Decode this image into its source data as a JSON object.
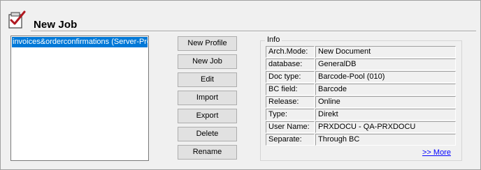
{
  "header": {
    "title": "New Job",
    "icon": "clipboard-check-icon"
  },
  "profile_list": {
    "items": [
      {
        "label": "invoices&orderconfirmations (Server-Profil",
        "selected": true
      }
    ]
  },
  "buttons": {
    "new_profile": "New Profile",
    "new_job": "New Job",
    "edit": "Edit",
    "import": "Import",
    "export": "Export",
    "delete": "Delete",
    "rename": "Rename"
  },
  "info": {
    "group_label": "Info",
    "rows": [
      {
        "key": "Arch.Mode:",
        "value": "New Document"
      },
      {
        "key": "database:",
        "value": "GeneralDB"
      },
      {
        "key": "Doc type:",
        "value": "Barcode-Pool (010)"
      },
      {
        "key": "BC field:",
        "value": "Barcode"
      },
      {
        "key": "Release:",
        "value": "Online"
      },
      {
        "key": "Type:",
        "value": "Direkt"
      },
      {
        "key": "User Name:",
        "value": "PRXDOCU - QA-PRXDOCU"
      },
      {
        "key": "Separate:",
        "value": "Through BC"
      }
    ],
    "more_link": ">> More"
  },
  "colors": {
    "selection": "#0078d7",
    "link": "#0000ff",
    "icon_check": "#b01820"
  }
}
